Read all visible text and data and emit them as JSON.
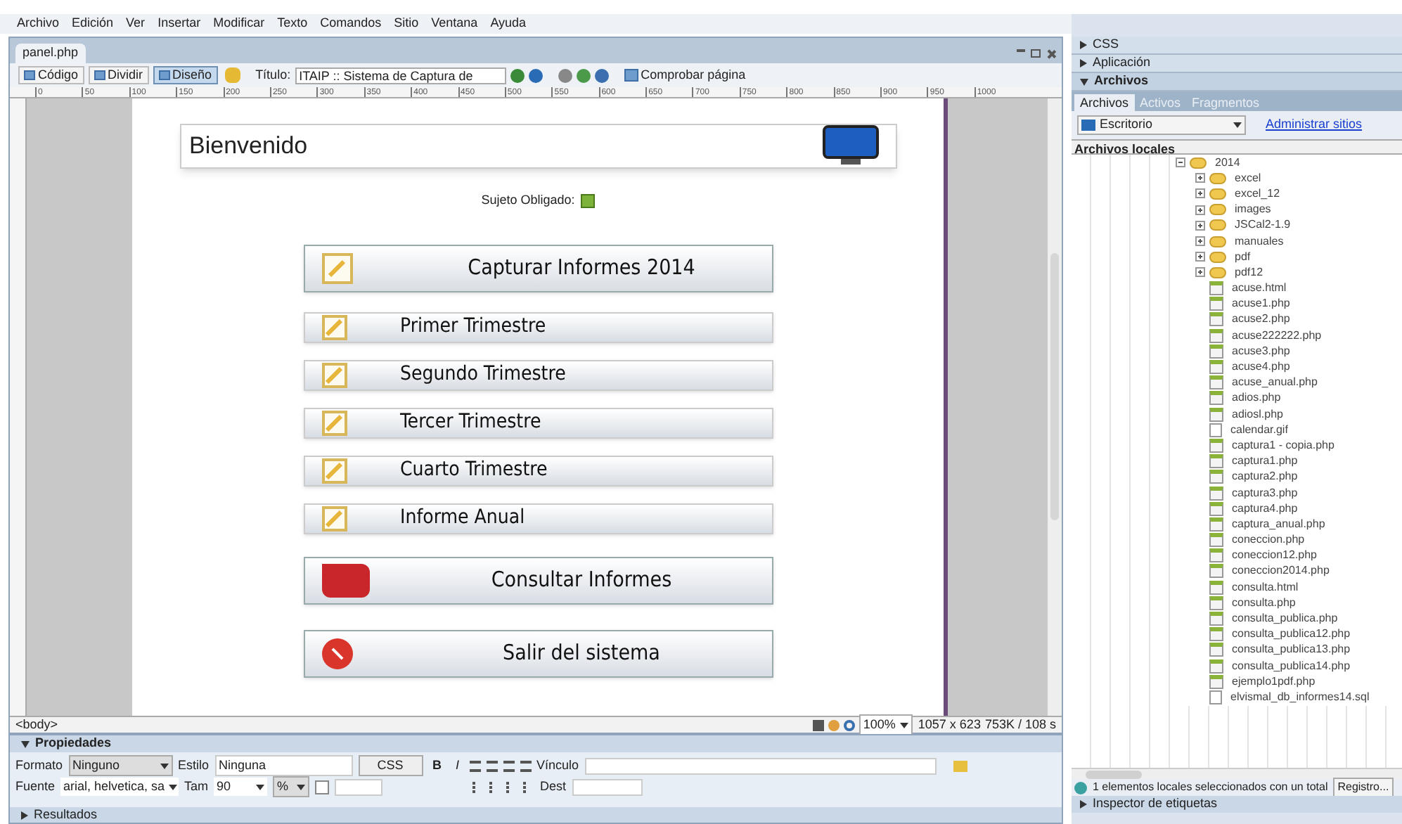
{
  "menu": [
    "Archivo",
    "Edición",
    "Ver",
    "Insertar",
    "Modificar",
    "Texto",
    "Comandos",
    "Sitio",
    "Ventana",
    "Ayuda"
  ],
  "document": {
    "tab": "panel.php",
    "view_buttons": [
      {
        "label": "Código",
        "selected": false
      },
      {
        "label": "Dividir",
        "selected": false
      },
      {
        "label": "Diseño",
        "selected": true
      }
    ],
    "title_label": "Título:",
    "title_value": "ITAIP :: Sistema de Captura de",
    "check_button": "Comprobar página",
    "ruler": [
      "0",
      "50",
      "100",
      "150",
      "200",
      "250",
      "300",
      "350",
      "400",
      "450",
      "500",
      "550",
      "600",
      "650",
      "700",
      "750",
      "800",
      "850",
      "900",
      "950",
      "1000"
    ],
    "page": {
      "heading": "Bienvenido",
      "subject_label": "Sujeto Obligado:",
      "buttons": [
        {
          "label": "Capturar Informes 2014",
          "kind": "capture"
        },
        {
          "label": "Primer Trimestre",
          "kind": "period"
        },
        {
          "label": "Segundo Trimestre",
          "kind": "period"
        },
        {
          "label": "Tercer Trimestre",
          "kind": "period"
        },
        {
          "label": "Cuarto Trimestre",
          "kind": "period"
        },
        {
          "label": "Informe Anual",
          "kind": "period"
        },
        {
          "label": "Consultar Informes",
          "kind": "consult"
        },
        {
          "label": "Salir del sistema",
          "kind": "exit"
        }
      ]
    },
    "status_bar": {
      "tag": "<body>",
      "zoom": "100%",
      "size": "1057 x 623",
      "weight": "753K / 108 s"
    }
  },
  "properties": {
    "title": "Propiedades",
    "expanded": true,
    "format_label": "Formato",
    "format": "Ninguno",
    "style_label": "Estilo",
    "style": "Ninguna",
    "css_button": "CSS",
    "bold": "B",
    "italic": "I",
    "link_label": "Vínculo",
    "font_label": "Fuente",
    "font": "arial, helvetica, sa",
    "size_label": "Tam",
    "size": "90",
    "unit": "%",
    "target_label": "Dest"
  },
  "results_panel": {
    "title": "Resultados",
    "expanded": false
  },
  "side_panels": [
    {
      "title": "CSS",
      "expanded": false
    },
    {
      "title": "Aplicación",
      "expanded": false
    },
    {
      "title": "Archivos",
      "expanded": true
    }
  ],
  "files_panel": {
    "tabs": [
      {
        "label": "Archivos",
        "selected": true
      },
      {
        "label": "Activos",
        "selected": false
      },
      {
        "label": "Fragmentos",
        "selected": false
      }
    ],
    "site": "Escritorio",
    "manage_link": "Administrar sitios",
    "header": "Archivos locales",
    "tree": [
      {
        "label": "2014",
        "kind": "folder",
        "expanded": true,
        "children": [
          {
            "label": "excel",
            "kind": "folder",
            "expanded": false
          },
          {
            "label": "excel_12",
            "kind": "folder",
            "expanded": false
          },
          {
            "label": "images",
            "kind": "folder",
            "expanded": false
          },
          {
            "label": "JSCal2-1.9",
            "kind": "folder",
            "expanded": false
          },
          {
            "label": "manuales",
            "kind": "folder",
            "expanded": false
          },
          {
            "label": "pdf",
            "kind": "folder",
            "expanded": false
          },
          {
            "label": "pdf12",
            "kind": "folder",
            "expanded": false
          },
          {
            "label": "acuse.html",
            "kind": "script"
          },
          {
            "label": "acuse1.php",
            "kind": "script"
          },
          {
            "label": "acuse2.php",
            "kind": "script"
          },
          {
            "label": "acuse222222.php",
            "kind": "script"
          },
          {
            "label": "acuse3.php",
            "kind": "script"
          },
          {
            "label": "acuse4.php",
            "kind": "script"
          },
          {
            "label": "acuse_anual.php",
            "kind": "script"
          },
          {
            "label": "adios.php",
            "kind": "script"
          },
          {
            "label": "adiosl.php",
            "kind": "script"
          },
          {
            "label": "calendar.gif",
            "kind": "plain"
          },
          {
            "label": "captura1 - copia.php",
            "kind": "script"
          },
          {
            "label": "captura1.php",
            "kind": "script"
          },
          {
            "label": "captura2.php",
            "kind": "script"
          },
          {
            "label": "captura3.php",
            "kind": "script"
          },
          {
            "label": "captura4.php",
            "kind": "script"
          },
          {
            "label": "captura_anual.php",
            "kind": "script"
          },
          {
            "label": "coneccion.php",
            "kind": "script"
          },
          {
            "label": "coneccion12.php",
            "kind": "script"
          },
          {
            "label": "coneccion2014.php",
            "kind": "script"
          },
          {
            "label": "consulta.html",
            "kind": "script"
          },
          {
            "label": "consulta.php",
            "kind": "script"
          },
          {
            "label": "consulta_publica.php",
            "kind": "script"
          },
          {
            "label": "consulta_publica12.php",
            "kind": "script"
          },
          {
            "label": "consulta_publica13.php",
            "kind": "script"
          },
          {
            "label": "consulta_publica14.php",
            "kind": "script"
          },
          {
            "label": "ejemplo1pdf.php",
            "kind": "script"
          },
          {
            "label": "elvismal_db_informes14.sql",
            "kind": "plain"
          }
        ]
      }
    ],
    "status": "1 elementos locales seleccionados con un total",
    "log_button": "Registro..."
  },
  "tag_inspector": {
    "title": "Inspector de etiquetas",
    "expanded": false
  }
}
